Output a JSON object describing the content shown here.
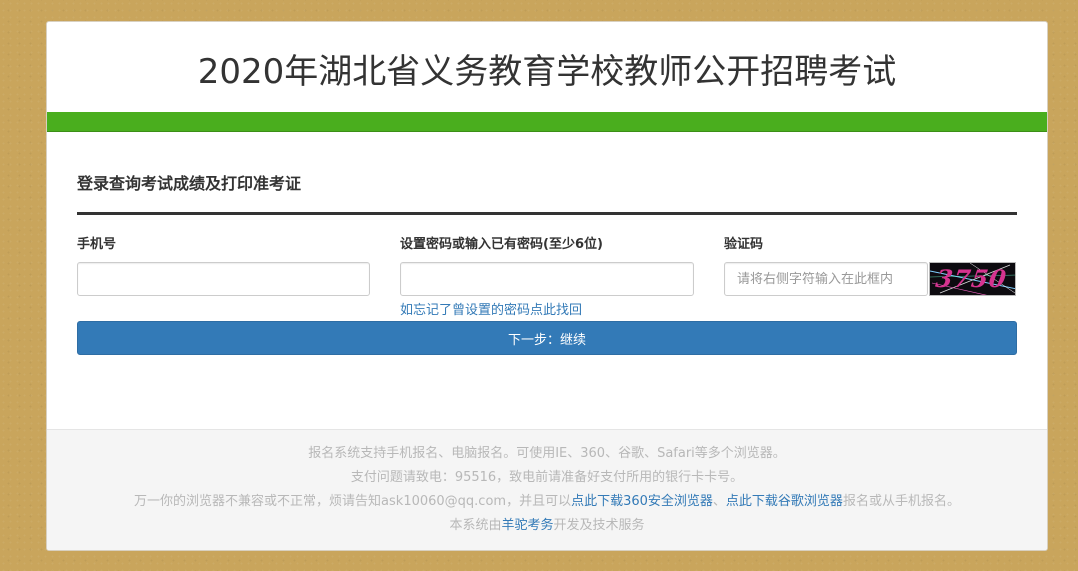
{
  "header": {
    "title": "2020年湖北省义务教育学校教师公开招聘考试"
  },
  "colors": {
    "accent_green": "#4aae1e",
    "button_blue": "#337ab7",
    "background": "#c9a55c"
  },
  "login": {
    "section_title": "登录查询考试成绩及打印准考证",
    "phone": {
      "label": "手机号",
      "value": "",
      "placeholder": ""
    },
    "password": {
      "label": "设置密码或输入已有密码(至少6位)",
      "value": "",
      "placeholder": ""
    },
    "forgot_link": "如忘记了曾设置的密码点此找回",
    "captcha": {
      "label": "验证码",
      "placeholder": "请将右侧字符输入在此框内",
      "image_text": "3750"
    },
    "next_button": "下一步：继续"
  },
  "footer": {
    "line1": "报名系统支持手机报名、电脑报名。可使用IE、360、谷歌、Safari等多个浏览器。",
    "line2": "支付问题请致电：95516，致电前请准备好支付所用的银行卡卡号。",
    "line3_prefix": "万一你的浏览器不兼容或不正常，烦请告知ask10060@qq.com，并且可以",
    "line3_link1": "点此下载360安全浏览器",
    "line3_sep": "、",
    "line3_link2": "点此下载谷歌浏览器",
    "line3_suffix": "报名或从手机报名。",
    "line4_prefix": "本系统由",
    "line4_link": "羊驼考务",
    "line4_suffix": "开发及技术服务"
  }
}
